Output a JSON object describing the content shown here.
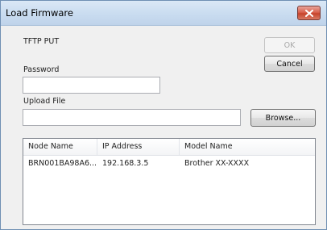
{
  "window": {
    "title": "Load Firmware",
    "close_icon": "close-icon"
  },
  "mode_label": "TFTP PUT",
  "buttons": {
    "ok": "OK",
    "cancel": "Cancel",
    "browse": "Browse..."
  },
  "password": {
    "label": "Password",
    "value": ""
  },
  "upload_file": {
    "label": "Upload File",
    "value": ""
  },
  "device_list": {
    "columns": [
      "Node Name",
      "IP Address",
      "Model Name"
    ],
    "rows": [
      [
        "BRN001BA98A6...",
        "192.168.3.5",
        "Brother XX-XXXX"
      ]
    ]
  }
}
